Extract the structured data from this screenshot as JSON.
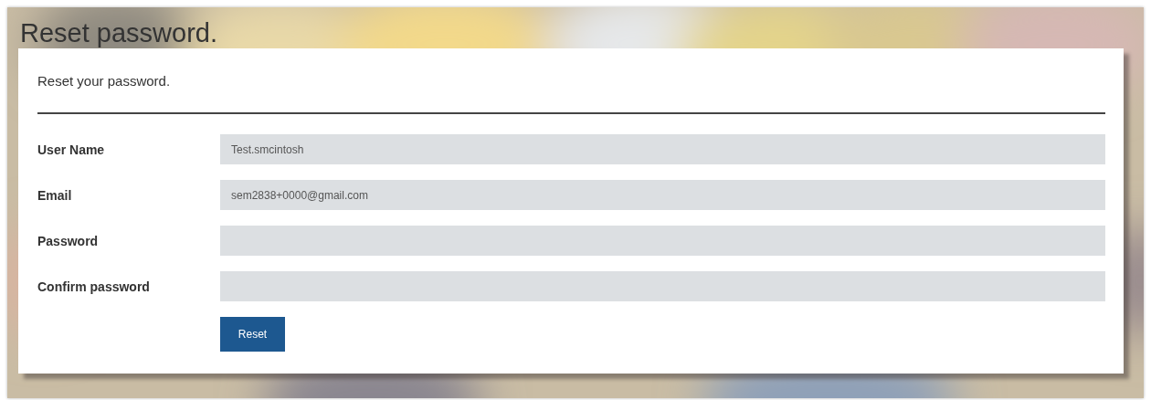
{
  "page": {
    "title": "Reset password."
  },
  "form": {
    "heading": "Reset your password.",
    "fields": [
      {
        "label": "User Name",
        "value": "Test.smcintosh"
      },
      {
        "label": "Email",
        "value": "sem2838+0000@gmail.com"
      },
      {
        "label": "Password"
      },
      {
        "label": "Confirm password"
      }
    ],
    "button": "Reset"
  }
}
